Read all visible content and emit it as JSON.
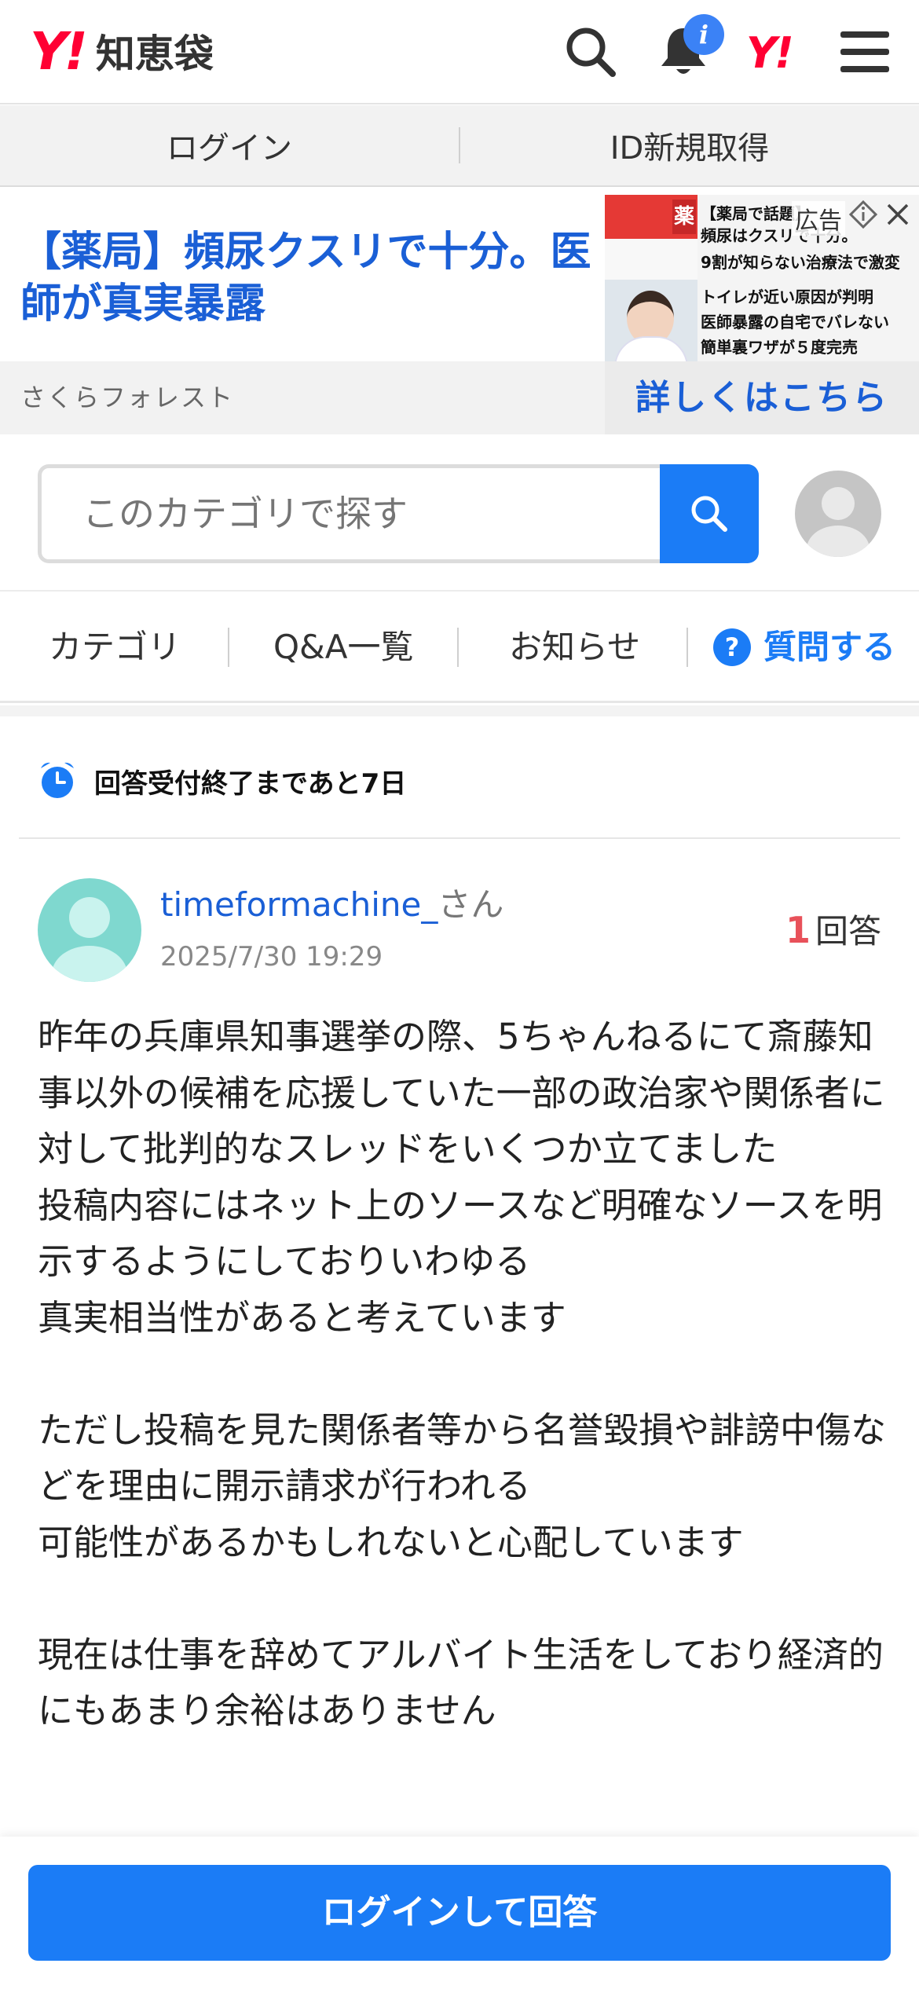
{
  "header": {
    "logo_mark": "Y!",
    "logo_text": "知恵袋",
    "notification_badge": "i",
    "yj_mark": "Y!"
  },
  "login_bar": {
    "login": "ログイン",
    "register": "ID新規取得"
  },
  "ad": {
    "headline": "【薬局】頻尿クスリで十分。医師が真実暴露",
    "image_lines": [
      "【薬局で話題】",
      "頻尿はクスリで十分。",
      "9割が知らない治療法で激変",
      "トイレが近い原因が判明",
      "医師暴露の自宅でバレない",
      "簡単裏ワザが５度完売"
    ],
    "image_sign": "薬",
    "label": "広告",
    "sponsor": "さくらフォレスト",
    "cta": "詳しくはこちら"
  },
  "search": {
    "placeholder": "このカテゴリで探す"
  },
  "nav": {
    "category": "カテゴリ",
    "qa_list": "Q&A一覧",
    "news": "お知らせ",
    "ask": "質問する",
    "ask_icon": "?"
  },
  "deadline": {
    "text": "回答受付終了まであと7日"
  },
  "question": {
    "username": "timeformachine_",
    "honorific": "さん",
    "date": "2025/7/30 19:29",
    "answer_count": "1",
    "answer_label": "回答",
    "body": "昨年の兵庫県知事選挙の際、5ちゃんねるにて斎藤知事以外の候補を応援していた一部の政治家や関係者に対して批判的なスレッドをいくつか立てました\n投稿内容にはネット上のソースなど明確なソースを明示するようにしておりいわゆる\n真実相当性があると考えています\n\nただし投稿を見た関係者等から名誉毀損や誹謗中傷などを理由に開示請求が行われる\n可能性があるかもしれないと心配しています\n\n現在は仕事を辞めてアルバイト生活をしており経済的にもあまり余裕はありません"
  },
  "bottom": {
    "cta": "ログインして回答"
  },
  "colors": {
    "brand_red": "#ff0033",
    "link_blue": "#1a5fd6",
    "button_blue": "#1b7cf6",
    "count_red": "#e8515a"
  }
}
